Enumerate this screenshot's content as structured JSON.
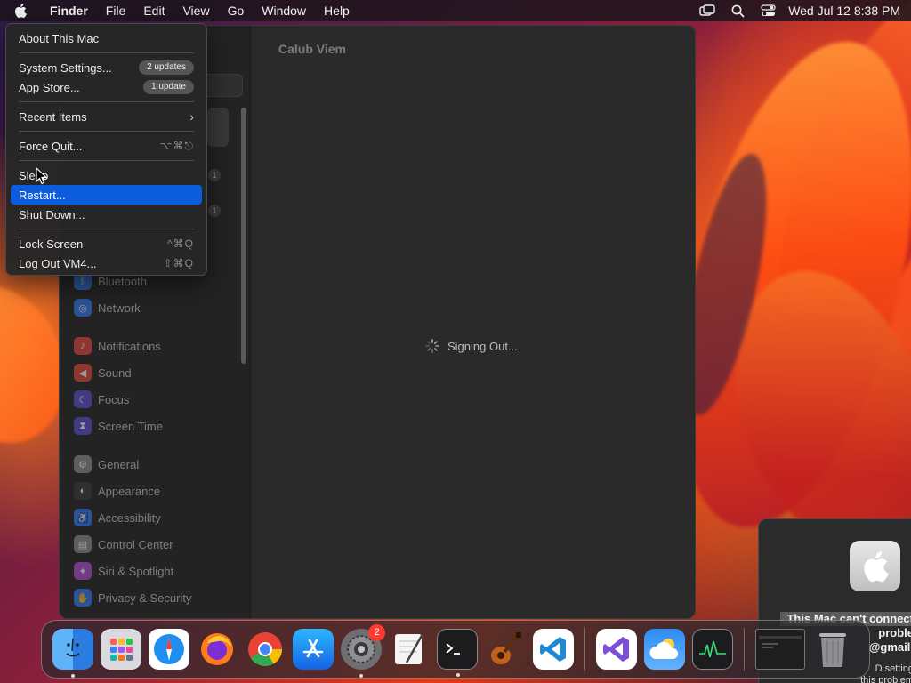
{
  "menubar": {
    "apple_icon": "apple-logo-icon",
    "app_name": "Finder",
    "menus": [
      "File",
      "Edit",
      "View",
      "Go",
      "Window",
      "Help"
    ],
    "status_icons": [
      "screen-mirroring-icon",
      "spotlight-search-icon",
      "control-center-icon"
    ],
    "clock": "Wed Jul 12  8:38 PM"
  },
  "apple_menu": {
    "about": "About This Mac",
    "system_settings": "System Settings...",
    "system_settings_badge": "2 updates",
    "app_store": "App Store...",
    "app_store_badge": "1 update",
    "recent_items": "Recent Items",
    "force_quit": "Force Quit...",
    "force_quit_shortcut": "⌥⌘⎋",
    "sleep": "Sleep",
    "restart": "Restart...",
    "shut_down": "Shut Down...",
    "lock_screen": "Lock Screen",
    "lock_screen_shortcut": "^⌘Q",
    "log_out": "Log Out VM4...",
    "log_out_shortcut": "⇧⌘Q"
  },
  "settings_window": {
    "pane_title": "Calub Viem",
    "status_text": "Signing Out...",
    "badge_1": "1",
    "badge_2": "1",
    "sidebar": [
      {
        "label": "Bluetooth",
        "icon": "bluetooth-icon",
        "color": "#2f7cf6"
      },
      {
        "label": "Network",
        "icon": "network-globe-icon",
        "color": "#2f7cf6"
      },
      {
        "label": "Notifications",
        "icon": "notifications-bell-icon",
        "color": "#e8463b"
      },
      {
        "label": "Sound",
        "icon": "sound-speaker-icon",
        "color": "#e8463b"
      },
      {
        "label": "Focus",
        "icon": "focus-moon-icon",
        "color": "#5b4fd1"
      },
      {
        "label": "Screen Time",
        "icon": "hourglass-icon",
        "color": "#5b4fd1"
      },
      {
        "label": "General",
        "icon": "gear-icon",
        "color": "#8e8e93"
      },
      {
        "label": "Appearance",
        "icon": "appearance-icon",
        "color": "#3a3a3c"
      },
      {
        "label": "Accessibility",
        "icon": "accessibility-icon",
        "color": "#2f7cf6"
      },
      {
        "label": "Control Center",
        "icon": "control-center-icon",
        "color": "#8e8e93"
      },
      {
        "label": "Siri & Spotlight",
        "icon": "siri-icon",
        "color": "#b14fd6"
      },
      {
        "label": "Privacy & Security",
        "icon": "hand-icon",
        "color": "#2f7cf6"
      }
    ]
  },
  "notice": {
    "line1": "This Mac can't connect",
    "line2": "proble",
    "line3": "@gmail.",
    "sub1": "D setting",
    "sub2": "this problem"
  },
  "dock": {
    "apps": [
      {
        "name": "Finder",
        "icon": "finder-icon",
        "running": true
      },
      {
        "name": "Launchpad",
        "icon": "launchpad-icon",
        "running": false
      },
      {
        "name": "Safari",
        "icon": "safari-compass-icon",
        "running": false
      },
      {
        "name": "Firefox",
        "icon": "firefox-icon",
        "running": false
      },
      {
        "name": "Chrome",
        "icon": "chrome-icon",
        "running": false
      },
      {
        "name": "App Store",
        "icon": "app-store-icon",
        "running": false
      },
      {
        "name": "System Settings",
        "icon": "system-settings-gear-icon",
        "running": true,
        "badge": "2"
      },
      {
        "name": "TextEdit",
        "icon": "textedit-icon",
        "running": false
      },
      {
        "name": "Terminal",
        "icon": "terminal-icon",
        "running": true
      },
      {
        "name": "GarageBand",
        "icon": "garageband-guitar-icon",
        "running": false
      },
      {
        "name": "Visual Studio Code",
        "icon": "vscode-icon",
        "running": false
      },
      {
        "name": "Visual Studio",
        "icon": "visual-studio-icon",
        "running": false
      },
      {
        "name": "Weather",
        "icon": "weather-cloud-icon",
        "running": false
      },
      {
        "name": "Activity Monitor",
        "icon": "activity-monitor-icon",
        "running": false
      }
    ],
    "recent_window": "terminal-window-thumbnail",
    "trash": "trash-icon"
  }
}
